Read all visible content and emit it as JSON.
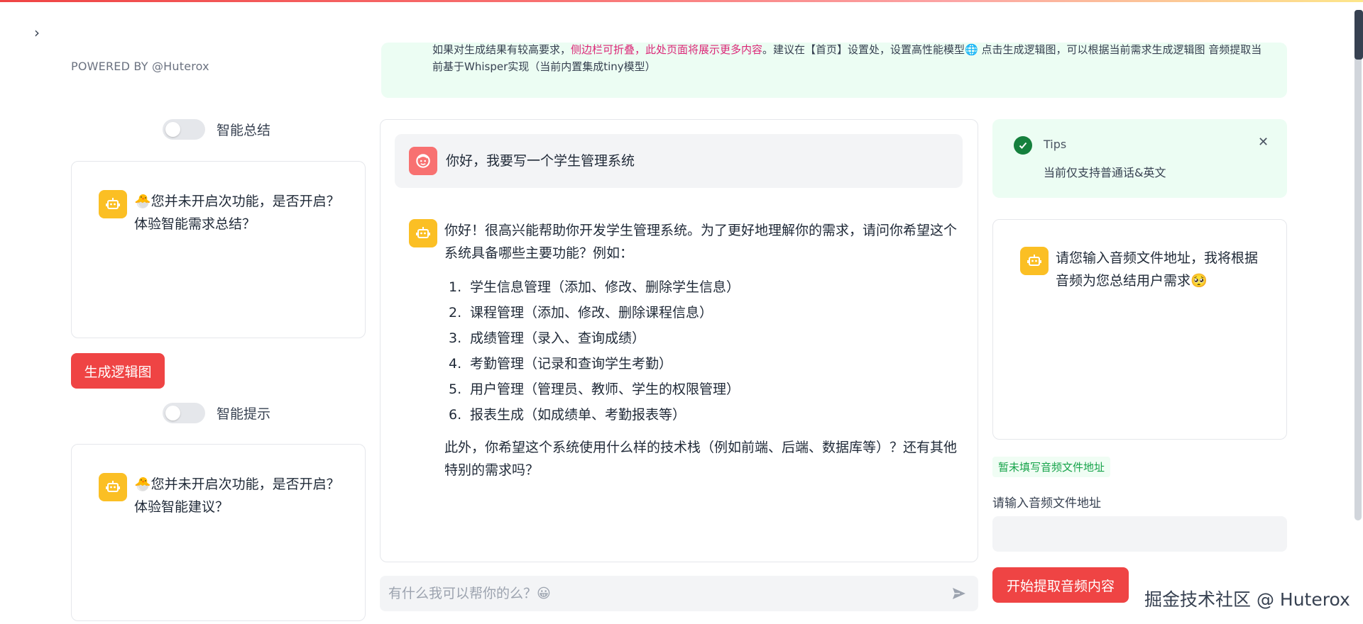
{
  "sidebar": {
    "powered_by": "POWERED BY @Huterox",
    "summary_toggle_label": "智能总结",
    "summary_message": "🐣您并未开启次功能，是否开启？体验智能需求总结？",
    "generate_button": "生成逻辑图",
    "hint_toggle_label": "智能提示",
    "hint_message": "🐣您并未开启次功能，是否开启？体验智能建议？"
  },
  "banner": {
    "line1_a": "如果对生成结果有较高要求，",
    "line1_pink": "侧边栏可折叠，此处页面将展示更多内容",
    "line1_b": "。建议在【首页】设置处，设置高性能模型🌐 点击生成逻辑图，可以根据当前需求生成逻辑图 音频提取当",
    "line2": "前基于Whisper实现（当前内置集成tiny模型）"
  },
  "chat": {
    "user_message": "你好，我要写一个学生管理系统",
    "reply_intro": "你好！很高兴能帮助你开发学生管理系统。为了更好地理解你的需求，请问你希望这个系统具备哪些主要功能？例如：",
    "reply_items": [
      {
        "num": "1.",
        "text": "学生信息管理（添加、修改、删除学生信息）"
      },
      {
        "num": "2.",
        "text": "课程管理（添加、修改、删除课程信息）"
      },
      {
        "num": "3.",
        "text": "成绩管理（录入、查询成绩）"
      },
      {
        "num": "4.",
        "text": "考勤管理（记录和查询学生考勤）"
      },
      {
        "num": "5.",
        "text": "用户管理（管理员、教师、学生的权限管理）"
      },
      {
        "num": "6.",
        "text": "报表生成（如成绩单、考勤报表等）"
      }
    ],
    "reply_outro": "此外，你希望这个系统使用什么样的技术栈（例如前端、后端、数据库等）？还有其他特别的需求吗？",
    "input_placeholder": "有什么我可以帮你的么？😀"
  },
  "right_panel": {
    "tips_title": "Tips",
    "tips_text": "当前仅支持普通话&英文",
    "audio_message": "请您输入音频文件地址，我将根据音频为您总结用户需求🥺",
    "status_badge": "暂未填写音频文件地址",
    "field_label": "请输入音频文件地址",
    "field_value": "",
    "extract_button": "开始提取音频内容"
  },
  "watermark": "掘金技术社区 @ Huterox",
  "colors": {
    "accent_red": "#ef4444",
    "bot_yellow": "#fbbf24",
    "success_green": "#15803d",
    "banner_bg": "#ecfdf3"
  },
  "icons": {
    "collapse": "chevron-right-icon",
    "bot": "robot-icon",
    "user": "user-face-icon",
    "send": "send-icon",
    "close": "close-icon",
    "check": "check-circle-icon"
  }
}
